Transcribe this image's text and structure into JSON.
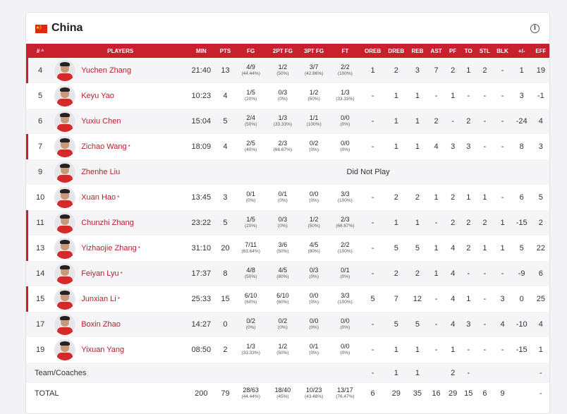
{
  "team": {
    "name": "China",
    "info_icon": "info-icon",
    "flag_color": "#de2910"
  },
  "accent": "#c9202e",
  "columns": [
    "#",
    "PLAYERS",
    "MIN",
    "PTS",
    "FG",
    "2PT FG",
    "3PT FG",
    "FT",
    "OREB",
    "DREB",
    "REB",
    "AST",
    "PF",
    "TO",
    "STL",
    "BLK",
    "+/-",
    "EFF"
  ],
  "sort_indicator": "^",
  "players": [
    {
      "num": "4",
      "name": "Yuchen Zhang",
      "star": "",
      "starter": true,
      "min": "21:40",
      "pts": "13",
      "fg": "4/9",
      "fg_p": "(44.44%)",
      "fg2": "1/2",
      "fg2_p": "(50%)",
      "fg3": "3/7",
      "fg3_p": "(42.86%)",
      "ft": "2/2",
      "ft_p": "(100%)",
      "oreb": "1",
      "dreb": "2",
      "reb": "3",
      "ast": "7",
      "pf": "2",
      "to": "1",
      "stl": "2",
      "blk": "-",
      "pm": "1",
      "eff": "19"
    },
    {
      "num": "5",
      "name": "Keyu Yao",
      "star": "",
      "starter": false,
      "min": "10:23",
      "pts": "4",
      "fg": "1/5",
      "fg_p": "(20%)",
      "fg2": "0/3",
      "fg2_p": "(0%)",
      "fg3": "1/2",
      "fg3_p": "(50%)",
      "ft": "1/3",
      "ft_p": "(33.33%)",
      "oreb": "-",
      "dreb": "1",
      "reb": "1",
      "ast": "-",
      "pf": "1",
      "to": "-",
      "stl": "-",
      "blk": "-",
      "pm": "3",
      "eff": "-1"
    },
    {
      "num": "6",
      "name": "Yuxiu Chen",
      "star": "",
      "starter": false,
      "min": "15:04",
      "pts": "5",
      "fg": "2/4",
      "fg_p": "(50%)",
      "fg2": "1/3",
      "fg2_p": "(33.33%)",
      "fg3": "1/1",
      "fg3_p": "(100%)",
      "ft": "0/0",
      "ft_p": "(0%)",
      "oreb": "-",
      "dreb": "1",
      "reb": "1",
      "ast": "2",
      "pf": "-",
      "to": "2",
      "stl": "-",
      "blk": "-",
      "pm": "-24",
      "eff": "4"
    },
    {
      "num": "7",
      "name": "Zichao Wang",
      "star": "*",
      "starter": true,
      "min": "18:09",
      "pts": "4",
      "fg": "2/5",
      "fg_p": "(40%)",
      "fg2": "2/3",
      "fg2_p": "(66.67%)",
      "fg3": "0/2",
      "fg3_p": "(0%)",
      "ft": "0/0",
      "ft_p": "(0%)",
      "oreb": "-",
      "dreb": "1",
      "reb": "1",
      "ast": "4",
      "pf": "3",
      "to": "3",
      "stl": "-",
      "blk": "-",
      "pm": "8",
      "eff": "3"
    },
    {
      "num": "9",
      "name": "Zhenhe Liu",
      "star": "",
      "starter": false,
      "dnp": "Did Not Play"
    },
    {
      "num": "10",
      "name": "Xuan Hao",
      "star": "*",
      "starter": false,
      "min": "13:45",
      "pts": "3",
      "fg": "0/1",
      "fg_p": "(0%)",
      "fg2": "0/1",
      "fg2_p": "(0%)",
      "fg3": "0/0",
      "fg3_p": "(0%)",
      "ft": "3/3",
      "ft_p": "(100%)",
      "oreb": "-",
      "dreb": "2",
      "reb": "2",
      "ast": "1",
      "pf": "2",
      "to": "1",
      "stl": "1",
      "blk": "-",
      "pm": "6",
      "eff": "5"
    },
    {
      "num": "11",
      "name": "Chunzhi Zhang",
      "star": "",
      "starter": true,
      "min": "23:22",
      "pts": "5",
      "fg": "1/5",
      "fg_p": "(20%)",
      "fg2": "0/3",
      "fg2_p": "(0%)",
      "fg3": "1/2",
      "fg3_p": "(50%)",
      "ft": "2/3",
      "ft_p": "(66.67%)",
      "oreb": "-",
      "dreb": "1",
      "reb": "1",
      "ast": "-",
      "pf": "2",
      "to": "2",
      "stl": "2",
      "blk": "1",
      "pm": "-15",
      "eff": "2"
    },
    {
      "num": "13",
      "name": "Yizhaojie Zhang",
      "star": "*",
      "starter": true,
      "min": "31:10",
      "pts": "20",
      "fg": "7/11",
      "fg_p": "(63.64%)",
      "fg2": "3/6",
      "fg2_p": "(50%)",
      "fg3": "4/5",
      "fg3_p": "(80%)",
      "ft": "2/2",
      "ft_p": "(100%)",
      "oreb": "-",
      "dreb": "5",
      "reb": "5",
      "ast": "1",
      "pf": "4",
      "to": "2",
      "stl": "1",
      "blk": "1",
      "pm": "5",
      "eff": "22"
    },
    {
      "num": "14",
      "name": "Feiyan Lyu",
      "star": "*",
      "starter": false,
      "min": "17:37",
      "pts": "8",
      "fg": "4/8",
      "fg_p": "(50%)",
      "fg2": "4/5",
      "fg2_p": "(80%)",
      "fg3": "0/3",
      "fg3_p": "(0%)",
      "ft": "0/1",
      "ft_p": "(0%)",
      "oreb": "-",
      "dreb": "2",
      "reb": "2",
      "ast": "1",
      "pf": "4",
      "to": "-",
      "stl": "-",
      "blk": "-",
      "pm": "-9",
      "eff": "6"
    },
    {
      "num": "15",
      "name": "Junxian Li",
      "star": "*",
      "starter": true,
      "min": "25:33",
      "pts": "15",
      "fg": "6/10",
      "fg_p": "(60%)",
      "fg2": "6/10",
      "fg2_p": "(60%)",
      "fg3": "0/0",
      "fg3_p": "(0%)",
      "ft": "3/3",
      "ft_p": "(100%)",
      "oreb": "5",
      "dreb": "7",
      "reb": "12",
      "ast": "-",
      "pf": "4",
      "to": "1",
      "stl": "-",
      "blk": "3",
      "pm": "0",
      "eff": "25"
    },
    {
      "num": "17",
      "name": "Boxin Zhao",
      "star": "",
      "starter": false,
      "min": "14:27",
      "pts": "0",
      "fg": "0/2",
      "fg_p": "(0%)",
      "fg2": "0/2",
      "fg2_p": "(0%)",
      "fg3": "0/0",
      "fg3_p": "(0%)",
      "ft": "0/0",
      "ft_p": "(0%)",
      "oreb": "-",
      "dreb": "5",
      "reb": "5",
      "ast": "-",
      "pf": "4",
      "to": "3",
      "stl": "-",
      "blk": "4",
      "pm": "-10",
      "eff": "4"
    },
    {
      "num": "19",
      "name": "Yixuan Yang",
      "star": "",
      "starter": false,
      "min": "08:50",
      "pts": "2",
      "fg": "1/3",
      "fg_p": "(33.33%)",
      "fg2": "1/2",
      "fg2_p": "(50%)",
      "fg3": "0/1",
      "fg3_p": "(0%)",
      "ft": "0/0",
      "ft_p": "(0%)",
      "oreb": "-",
      "dreb": "1",
      "reb": "1",
      "ast": "-",
      "pf": "1",
      "to": "-",
      "stl": "-",
      "blk": "-",
      "pm": "-15",
      "eff": "1"
    }
  ],
  "team_row": {
    "label": "Team/Coaches",
    "oreb": "-",
    "dreb": "1",
    "reb": "1",
    "ast": "",
    "pf": "2",
    "to": "-",
    "stl": "",
    "blk": "",
    "pm": "",
    "eff": "-"
  },
  "total_row": {
    "label": "TOTAL",
    "min": "200",
    "pts": "79",
    "fg": "28/63",
    "fg_p": "(44.44%)",
    "fg2": "18/40",
    "fg2_p": "(45%)",
    "fg3": "10/23",
    "fg3_p": "(43.48%)",
    "ft": "13/17",
    "ft_p": "(76.47%)",
    "oreb": "6",
    "dreb": "29",
    "reb": "35",
    "ast": "16",
    "pf": "29",
    "to": "15",
    "stl": "6",
    "blk": "9",
    "pm": "",
    "eff": "-"
  }
}
